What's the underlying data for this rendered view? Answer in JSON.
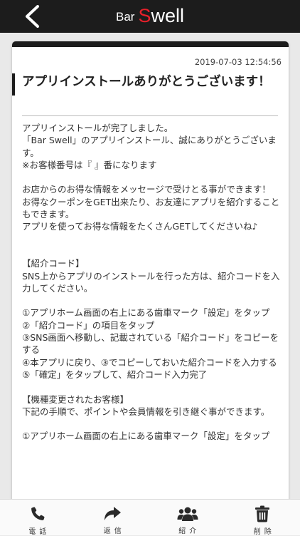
{
  "header": {
    "logo_part1": "Bar",
    "logo_part2": "S",
    "logo_part3": "well",
    "back_icon": "chevron-left-icon"
  },
  "message": {
    "date": "2019-07-03 12:54:56",
    "title": "アプリインストールありがとうございます！",
    "body": "アプリインストールが完了しました。\n「Bar Swell」のアプリインストール、誠にありがとうございます。\n※お客様番号は『 』番になります\n\nお店からのお得な情報をメッセージで受けとる事ができます！\nお得なクーポンをGET出来たり、お友達にアプリを紹介することもできます。\nアプリを使ってお得な情報をたくさんGETしてくださいね♪\n\n\n【紹介コード】\nSNS上からアプリのインストールを行った方は、紹介コードを入力してください。\n\n①アプリホーム画面の右上にある歯車マーク「設定」をタップ\n②「紹介コード」の項目をタップ\n③SNS画面へ移動し、記載されている「紹介コード」をコピーをする\n④本アプリに戻り、③でコピーしておいた紹介コードを入力する\n⑤「確定」をタップして、紹介コード入力完了\n\n【機種変更されたお客様】\n下記の手順で、ポイントや会員情報を引き継ぐ事ができます。\n\n①アプリホーム画面の右上にある歯車マーク「設定」をタップ"
  },
  "tabs": [
    {
      "label": "電話",
      "icon": "phone-icon"
    },
    {
      "label": "返信",
      "icon": "reply-icon"
    },
    {
      "label": "紹介",
      "icon": "users-icon"
    },
    {
      "label": "削除",
      "icon": "trash-icon"
    }
  ]
}
